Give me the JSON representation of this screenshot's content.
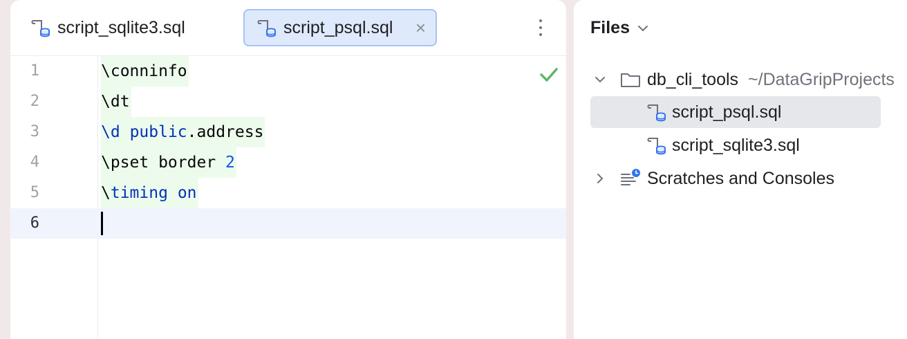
{
  "editor": {
    "tabs": [
      {
        "label": "script_sqlite3.sql",
        "active": false
      },
      {
        "label": "script_psql.sql",
        "active": true
      }
    ],
    "close_glyph": "×",
    "lines": [
      {
        "number": "1",
        "tokens": [
          "\\conninfo"
        ]
      },
      {
        "number": "2",
        "tokens": [
          "\\dt"
        ]
      },
      {
        "number": "3",
        "tokens": [
          "\\d",
          " ",
          "public",
          ".address"
        ]
      },
      {
        "number": "4",
        "tokens": [
          "\\pset border",
          " ",
          "2"
        ]
      },
      {
        "number": "5",
        "tokens": [
          "\\",
          "timing",
          " ",
          "on"
        ]
      },
      {
        "number": "6",
        "tokens": []
      }
    ],
    "current_line": "6",
    "status_icon": "check-icon"
  },
  "files_panel": {
    "title": "Files",
    "tree": {
      "root_label": "db_cli_tools",
      "root_path": "~/DataGripProjects",
      "children": [
        {
          "label": "script_psql.sql",
          "selected": true
        },
        {
          "label": "script_sqlite3.sql",
          "selected": false
        }
      ],
      "scratches_label": "Scratches and Consoles"
    }
  },
  "colors": {
    "accent": "#3574f0",
    "tab_active_bg": "#dfe9fc",
    "keyword": "#0033b3",
    "number": "#1750eb",
    "changed_line_bg": "#edfbed",
    "ok_green": "#5fb865"
  }
}
